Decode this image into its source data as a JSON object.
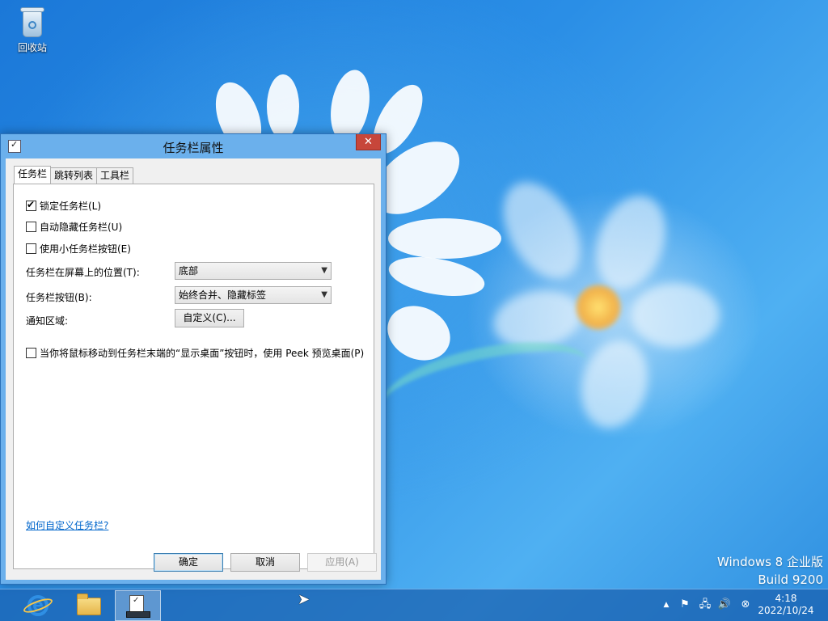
{
  "desktop": {
    "icons": [
      {
        "label": "回收站",
        "icon": "recycle-bin-icon"
      }
    ],
    "watermark": {
      "line1": "Windows 8 企业版",
      "line2": "Build 9200"
    }
  },
  "dialog": {
    "title": "任务栏属性",
    "close_glyph": "✕",
    "tabs": [
      {
        "label": "任务栏",
        "active": true
      },
      {
        "label": "跳转列表",
        "active": false
      },
      {
        "label": "工具栏",
        "active": false
      }
    ],
    "options": {
      "lock_taskbar": {
        "label": "锁定任务栏(L)",
        "checked": true
      },
      "auto_hide": {
        "label": "自动隐藏任务栏(U)",
        "checked": false
      },
      "small_buttons": {
        "label": "使用小任务栏按钮(E)",
        "checked": false
      },
      "peek": {
        "label": "当你将鼠标移动到任务栏末端的“显示桌面”按钮时，使用 Peek 预览桌面(P)",
        "checked": false
      }
    },
    "position": {
      "label": "任务栏在屏幕上的位置(T):",
      "value": "底部"
    },
    "buttons_mode": {
      "label": "任务栏按钮(B):",
      "value": "始终合并、隐藏标签"
    },
    "notification": {
      "label": "通知区域:",
      "button": "自定义(C)..."
    },
    "help_link": "如何自定义任务栏?",
    "footer": {
      "ok": "确定",
      "cancel": "取消",
      "apply": "应用(A)",
      "apply_enabled": false
    }
  },
  "taskbar": {
    "pinned": [
      {
        "name": "Internet Explorer",
        "icon": "internet-explorer-icon"
      },
      {
        "name": "File Explorer",
        "icon": "folder-icon"
      },
      {
        "name": "任务栏属性",
        "icon": "taskbar-properties-icon",
        "active": true
      }
    ],
    "tray_icons": [
      "show-hidden-icons-chevron-icon",
      "action-center-flag-icon",
      "network-icon",
      "volume-icon",
      "close-circle-icon"
    ],
    "clock": {
      "time": "4:18",
      "date": "2022/10/24"
    }
  },
  "colors": {
    "wallpaper": "#2a8ee6",
    "window_frame": "#6bb0ec",
    "close_button": "#c7463a",
    "link": "#0066cc"
  }
}
